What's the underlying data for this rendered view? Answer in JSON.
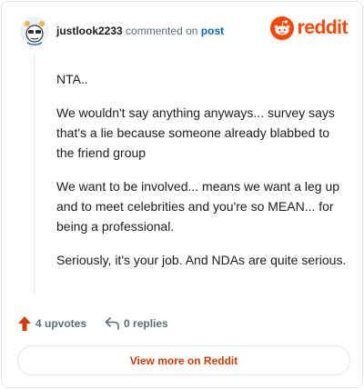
{
  "header": {
    "username": "justlook2233",
    "verb": "commented on",
    "post_link": "post",
    "brand_name": "reddit",
    "brand_color": "#ff4500"
  },
  "comment": {
    "paragraphs": [
      "NTA..",
      "We wouldn't say anything anyways... survey says that's a lie because someone already blabbed to the friend group",
      "We want to be involved... means we want a leg up and to meet celebrities and you're so MEAN... for being a professional.",
      "Seriously, it's your job. And NDAs are quite serious."
    ]
  },
  "actions": {
    "upvotes_label": "4 upvotes",
    "upvote_icon": "upvote-arrow-icon",
    "replies_label": "0 replies",
    "reply_icon": "reply-arrow-icon"
  },
  "footer": {
    "view_button_label": "View more on Reddit"
  }
}
